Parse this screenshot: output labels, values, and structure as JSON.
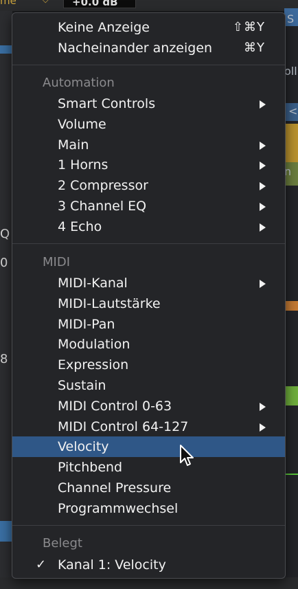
{
  "background": {
    "mode_label": "me",
    "value_readout": "+0.0 dB",
    "left_fragments": [
      "Q",
      "0",
      "8"
    ],
    "right_fragments": [
      "S",
      "oll",
      "<",
      "n"
    ]
  },
  "menu": {
    "top_items": [
      {
        "label": "Keine Anzeige",
        "shortcut": "⇧⌘Y"
      },
      {
        "label": "Nacheinander anzeigen",
        "shortcut": "⌘Y"
      }
    ],
    "automation_header": "Automation",
    "automation_items": [
      {
        "label": "Smart Controls",
        "submenu": true
      },
      {
        "label": "Volume",
        "submenu": false
      },
      {
        "label": "Main",
        "submenu": true
      },
      {
        "label": "1 Horns",
        "submenu": true
      },
      {
        "label": "2 Compressor",
        "submenu": true
      },
      {
        "label": "3 Channel EQ",
        "submenu": true
      },
      {
        "label": "4 Echo",
        "submenu": true
      }
    ],
    "midi_header": "MIDI",
    "midi_items": [
      {
        "label": "MIDI-Kanal",
        "submenu": true
      },
      {
        "label": "MIDI-Lautstärke",
        "submenu": false
      },
      {
        "label": "MIDI-Pan",
        "submenu": false
      },
      {
        "label": "Modulation",
        "submenu": false
      },
      {
        "label": "Expression",
        "submenu": false
      },
      {
        "label": "Sustain",
        "submenu": false
      },
      {
        "label": "MIDI Control 0-63",
        "submenu": true
      },
      {
        "label": "MIDI Control 64-127",
        "submenu": true
      },
      {
        "label": "Velocity",
        "submenu": false,
        "selected": true
      },
      {
        "label": "Pitchbend",
        "submenu": false
      },
      {
        "label": "Channel Pressure",
        "submenu": false
      },
      {
        "label": "Programmwechsel",
        "submenu": false
      }
    ],
    "used_header": "Belegt",
    "used_items": [
      {
        "label": "Kanal 1: Velocity",
        "checked": true,
        "check_glyph": "✓"
      }
    ]
  },
  "colors": {
    "highlight": "#2f5787",
    "menu_bg": "#242528",
    "section_text": "#8a8a8d"
  },
  "icons": {
    "submenu": "chevron-right-icon",
    "check": "checkmark-icon",
    "cursor": "mouse-pointer-icon"
  }
}
